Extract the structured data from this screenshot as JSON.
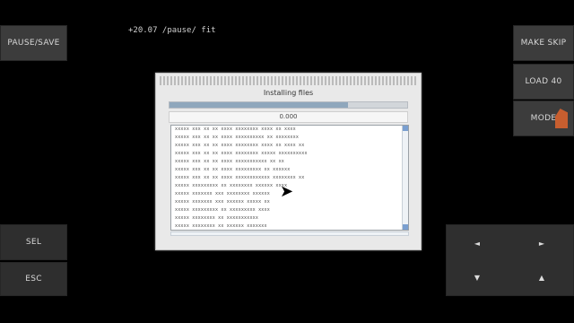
{
  "status": {
    "text": "+20.07 /pause/ fit"
  },
  "left_buttons": {
    "top": "PAUSE/SAVE",
    "mid": "SEL",
    "bottom": "ESC"
  },
  "right_buttons": {
    "top": "MAKE SKIP",
    "mid": "LOAD 40",
    "bottom": "MODE"
  },
  "dpad": {
    "ul": "◄",
    "ur": "►",
    "dl": "▼",
    "dr": "▲"
  },
  "dialog": {
    "title": "Installing files",
    "progress_percent": 75,
    "label": "0.000",
    "log_lines": [
      "xxxxx xxx xx xx xxxx xxxxxxxx xxxx xx xxxx",
      "xxxxx xxx xx xx xxxx xxxxxxxxxx xx xxxxxxxx",
      "xxxxx xxx xx xx xxxx xxxxxxxx xxxx xx xxxx xx",
      "xxxxx xxx xx xx xxxx xxxxxxxx xxxxx xxxxxxxxxx",
      "xxxxx xxx xx xx xxxx xxxxxxxxxxx xx xx",
      "xxxxx xxx xx xx xxxx xxxxxxxxx xx xxxxxx",
      "xxxxx xxx xx xx xxxx xxxxxxxxxxxx xxxxxxxx xx",
      "xxxxx xxxxxxxxx xx xxxxxxxx xxxxxx xxxx",
      "xxxxx xxxxxxx xxx xxxxxxxx xxxxxx",
      "xxxxx xxxxxxx xxx xxxxxx xxxxx xx",
      "xxxxx xxxxxxxxx xx xxxxxxxxx xxxx",
      "xxxxx xxxxxxxx xx xxxxxxxxxxx",
      "xxxxx xxxxxxxx xx xxxxxx xxxxxxx"
    ]
  }
}
